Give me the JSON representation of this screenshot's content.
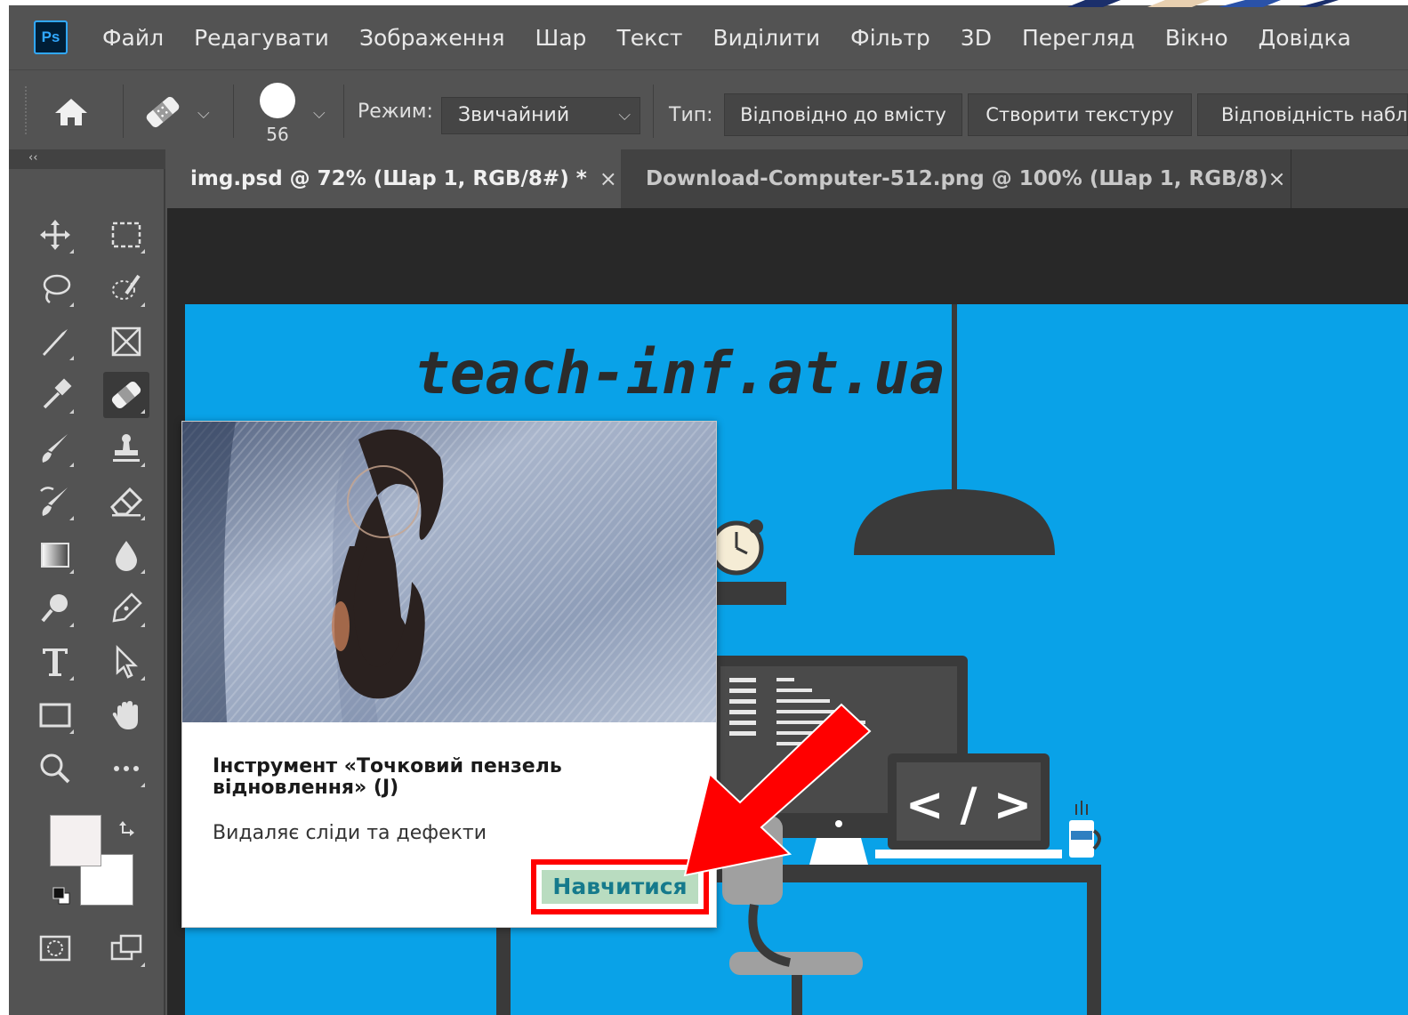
{
  "app": {
    "logo_text": "Ps",
    "accent_color": "#31a8ff"
  },
  "menu": {
    "items": [
      "Файл",
      "Редагувати",
      "Зображення",
      "Шар",
      "Текст",
      "Виділити",
      "Фільтр",
      "3D",
      "Перегляд",
      "Вікно",
      "Довідка"
    ]
  },
  "options": {
    "brush_size": "56",
    "mode_label": "Режим:",
    "mode_value": "Звичайний",
    "type_label": "Тип:",
    "type_buttons": [
      "Відповідно до вмісту",
      "Створити текстуру",
      "Відповідність набл"
    ]
  },
  "toolbox": {
    "collapse_label": "‹‹",
    "foreground_color": "#f4f0f0",
    "background_color": "#ffffff"
  },
  "tabs": [
    {
      "label": "img.psd @ 72% (Шар 1, RGB/8#) *",
      "close": "×"
    },
    {
      "label": "Download-Computer-512.png @ 100% (Шар 1, RGB/8)",
      "close": "×"
    }
  ],
  "canvas": {
    "watermark": "teach-inf.at.ua",
    "code_sign": "< / >",
    "background_color": "#09a2e8"
  },
  "tooltip": {
    "title": "Інструмент «Точковий пензель відновлення» (J)",
    "description": "Видаляє сліди та дефекти",
    "learn_button": "Навчитися"
  },
  "annotation": {
    "highlight_color": "#ff0000"
  }
}
